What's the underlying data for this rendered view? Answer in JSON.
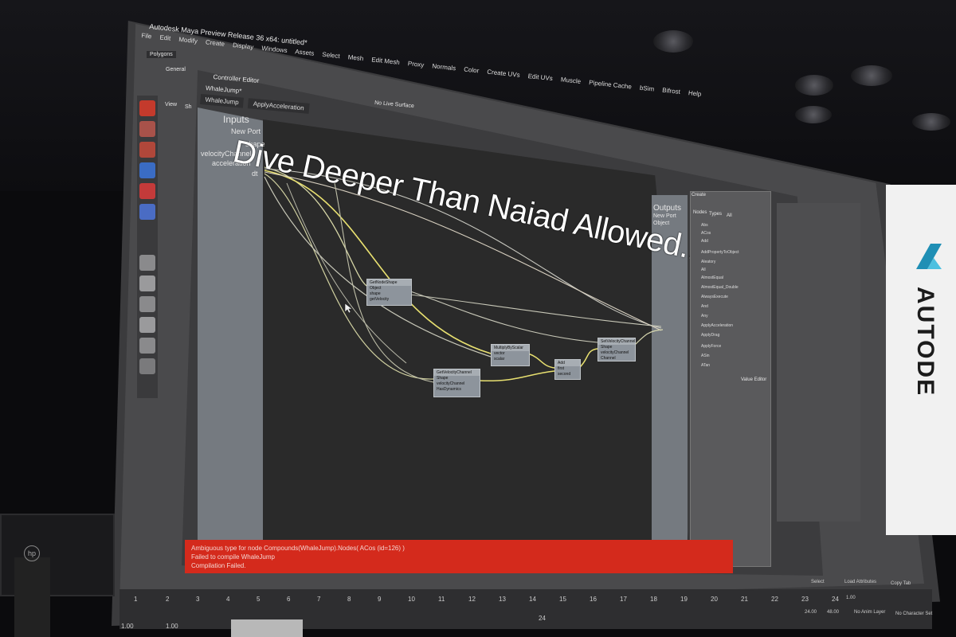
{
  "scene": {
    "headline": "Dive Deeper Than Naiad Allowed..."
  },
  "maya": {
    "window_title": "Autodesk Maya Preview Release 36 x64: untitled*",
    "menu": [
      "File",
      "Edit",
      "Modify",
      "Create",
      "Display",
      "Windows",
      "Assets",
      "Select",
      "Mesh",
      "Edit Mesh",
      "Proxy",
      "Normals",
      "Color",
      "Create UVs",
      "Edit UVs",
      "Muscle",
      "Pipeline Cache",
      "bSim",
      "Bifrost",
      "Help"
    ],
    "mode_dropdown": "Polygons",
    "shelf_tab": "General",
    "panel_menu": [
      "View",
      "Sh"
    ],
    "live_surface": "No Live Surface"
  },
  "controller_editor": {
    "title": "Controller Editor",
    "breadcrumb": "WhaleJump*",
    "tabs": [
      "WhaleJump",
      "ApplyAcceleration"
    ],
    "inputs_header": "Inputs",
    "inputs": [
      "New Port",
      "shape",
      "velocityChannel",
      "acceleration",
      "dt"
    ],
    "outputs_header": "Outputs",
    "outputs": [
      "New Port",
      "Object"
    ]
  },
  "graph": {
    "nodes": [
      {
        "title": "GetNodeShape",
        "ports": [
          "Object",
          "shape",
          "getVelocity"
        ]
      },
      {
        "title": "MultiplyByScalar",
        "ports": [
          "vector",
          "scalar",
          "result"
        ]
      },
      {
        "title": "GetVelocityChannel",
        "ports": [
          "Shape",
          "velocityChannel",
          "HasDynamics"
        ]
      },
      {
        "title": "Add",
        "ports": [
          "first",
          "second",
          "result"
        ]
      },
      {
        "title": "SetVelocityChannel",
        "ports": [
          "Shape",
          "velocityChannel",
          "Channel"
        ]
      }
    ]
  },
  "create_panel": {
    "title": "Create",
    "tabs": [
      "Nodes",
      "Types",
      "All"
    ],
    "items": [
      "Abs",
      "ACos",
      "Add",
      "AddPropertyToObject",
      "Aleatory",
      "All",
      "AlmostEqual",
      "AlmostEqual_Double",
      "AlwaysExecute",
      "And",
      "Any",
      "ApplyAcceleration",
      "ApplyDrag",
      "ApplyForce",
      "ASin",
      "ATan"
    ],
    "footer": "Value Editor"
  },
  "errors": {
    "line1": "Ambiguous type for node Compounds(WhaleJump).Nodes( ACos (id=126) )",
    "line2": "Failed to compile WhaleJump",
    "line3": "Compilation Failed."
  },
  "timeline": {
    "range_start": "1.00",
    "range_current": "1.00",
    "frame_mid": "24",
    "range_end_a": "24.00",
    "range_end_b": "48.00",
    "anim_layer": "No Anim Layer",
    "char_set": "No Character Set",
    "frame_label": "1.00",
    "buttons": [
      "Select",
      "Load Attributes",
      "Copy Tab"
    ],
    "ticks": [
      "1",
      "2",
      "3",
      "4",
      "5",
      "6",
      "7",
      "8",
      "9",
      "10",
      "11",
      "12",
      "13",
      "14",
      "15",
      "16",
      "17",
      "18",
      "19",
      "20",
      "21",
      "22",
      "23",
      "24"
    ]
  },
  "banner": {
    "word": "AUTODE"
  },
  "monitor": {
    "brand": "hp"
  }
}
